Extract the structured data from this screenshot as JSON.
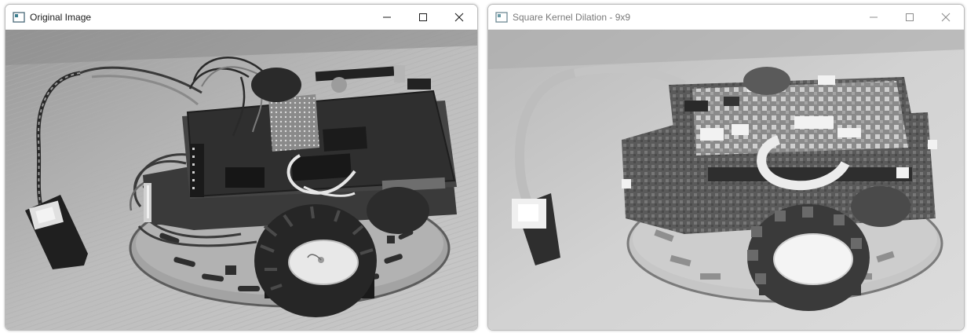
{
  "windows": [
    {
      "title": "Original Image",
      "state": "active",
      "image": "grayscale photo of a small two-wheeled robot chassis with an Arduino-style board, wires and a servo module on a wooden table"
    },
    {
      "title": "Square Kernel Dilation - 9x9",
      "state": "inactive",
      "image": "same robot photo after morphological dilation with a 9x9 square kernel — blocky, brightened, blurred"
    }
  ],
  "controls": {
    "minimize": "minimize-icon",
    "maximize": "maximize-icon",
    "close": "close-icon"
  },
  "colors": {
    "titlebar_bg": "#ffffff",
    "active_text": "#1a1a1a",
    "inactive_text": "#7a7a7a",
    "border": "#bcbcbc"
  }
}
